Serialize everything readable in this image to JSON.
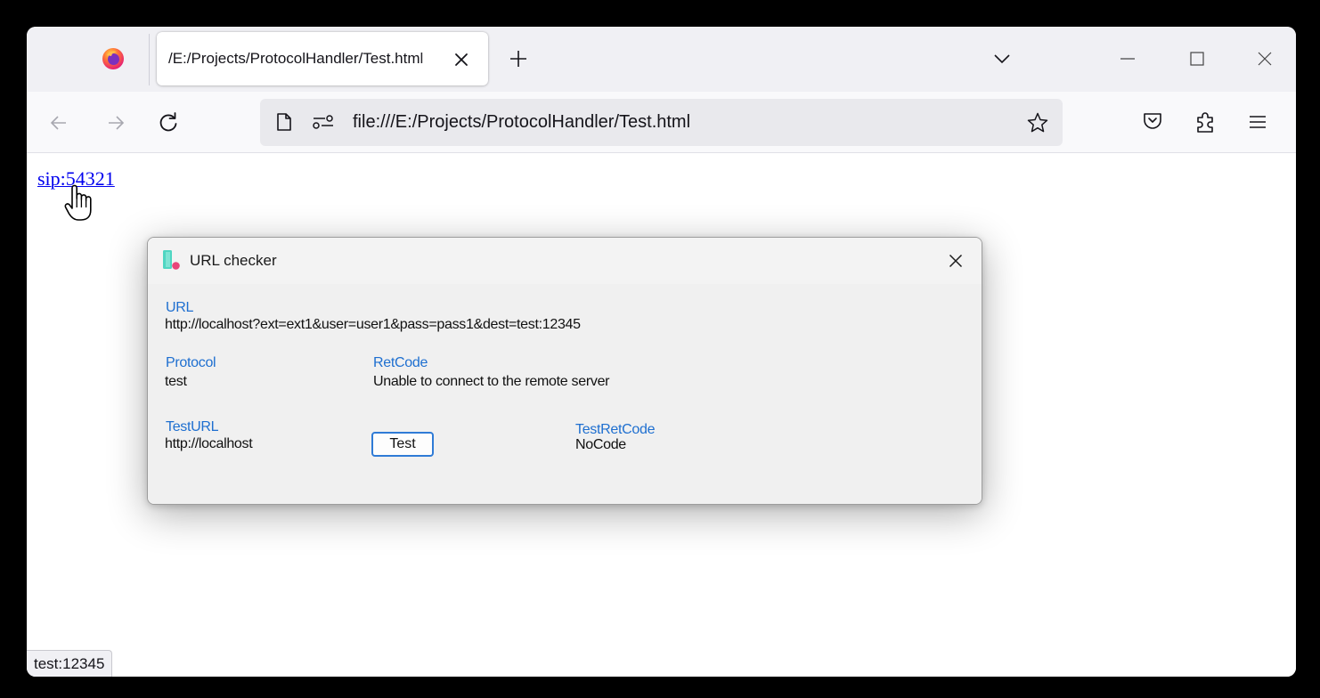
{
  "browser": {
    "tab": {
      "title": "/E:/Projects/ProtocolHandler/Test.html"
    },
    "address": {
      "url": "file:///E:/Projects/ProtocolHandler/Test.html"
    },
    "status_text": "test:12345"
  },
  "page": {
    "link_text": "sip:54321"
  },
  "dialog": {
    "title": "URL checker",
    "url_label": "URL",
    "url_value": "http://localhost?ext=ext1&user=user1&pass=pass1&dest=test:12345",
    "protocol_label": "Protocol",
    "protocol_value": "test",
    "retcode_label": "RetCode",
    "retcode_value": "Unable to connect to the remote server",
    "testurl_label": "TestURL",
    "testurl_value": "http://localhost",
    "test_button": "Test",
    "testretcode_label": "TestRetCode",
    "testretcode_value": "NoCode"
  },
  "icons": {
    "browser_logo": "firefox-logo-icon",
    "tab_close": "close-icon",
    "new_tab": "plus-icon",
    "tab_list": "chevron-down-icon",
    "minimize": "minimize-icon",
    "maximize": "maximize-icon",
    "window_close": "close-icon",
    "back": "arrow-left-icon",
    "forward": "arrow-right-icon",
    "reload": "reload-icon",
    "page": "page-icon",
    "permissions": "permissions-icon",
    "bookmark": "star-icon",
    "pocket": "pocket-icon",
    "extensions": "puzzle-icon",
    "menu": "hamburger-menu-icon",
    "cursor": "hand-cursor-icon",
    "app": "app-icon"
  },
  "colors": {
    "label_blue": "#1e6fd0",
    "link": "#0000ee",
    "button_border": "#2f7bd6"
  }
}
